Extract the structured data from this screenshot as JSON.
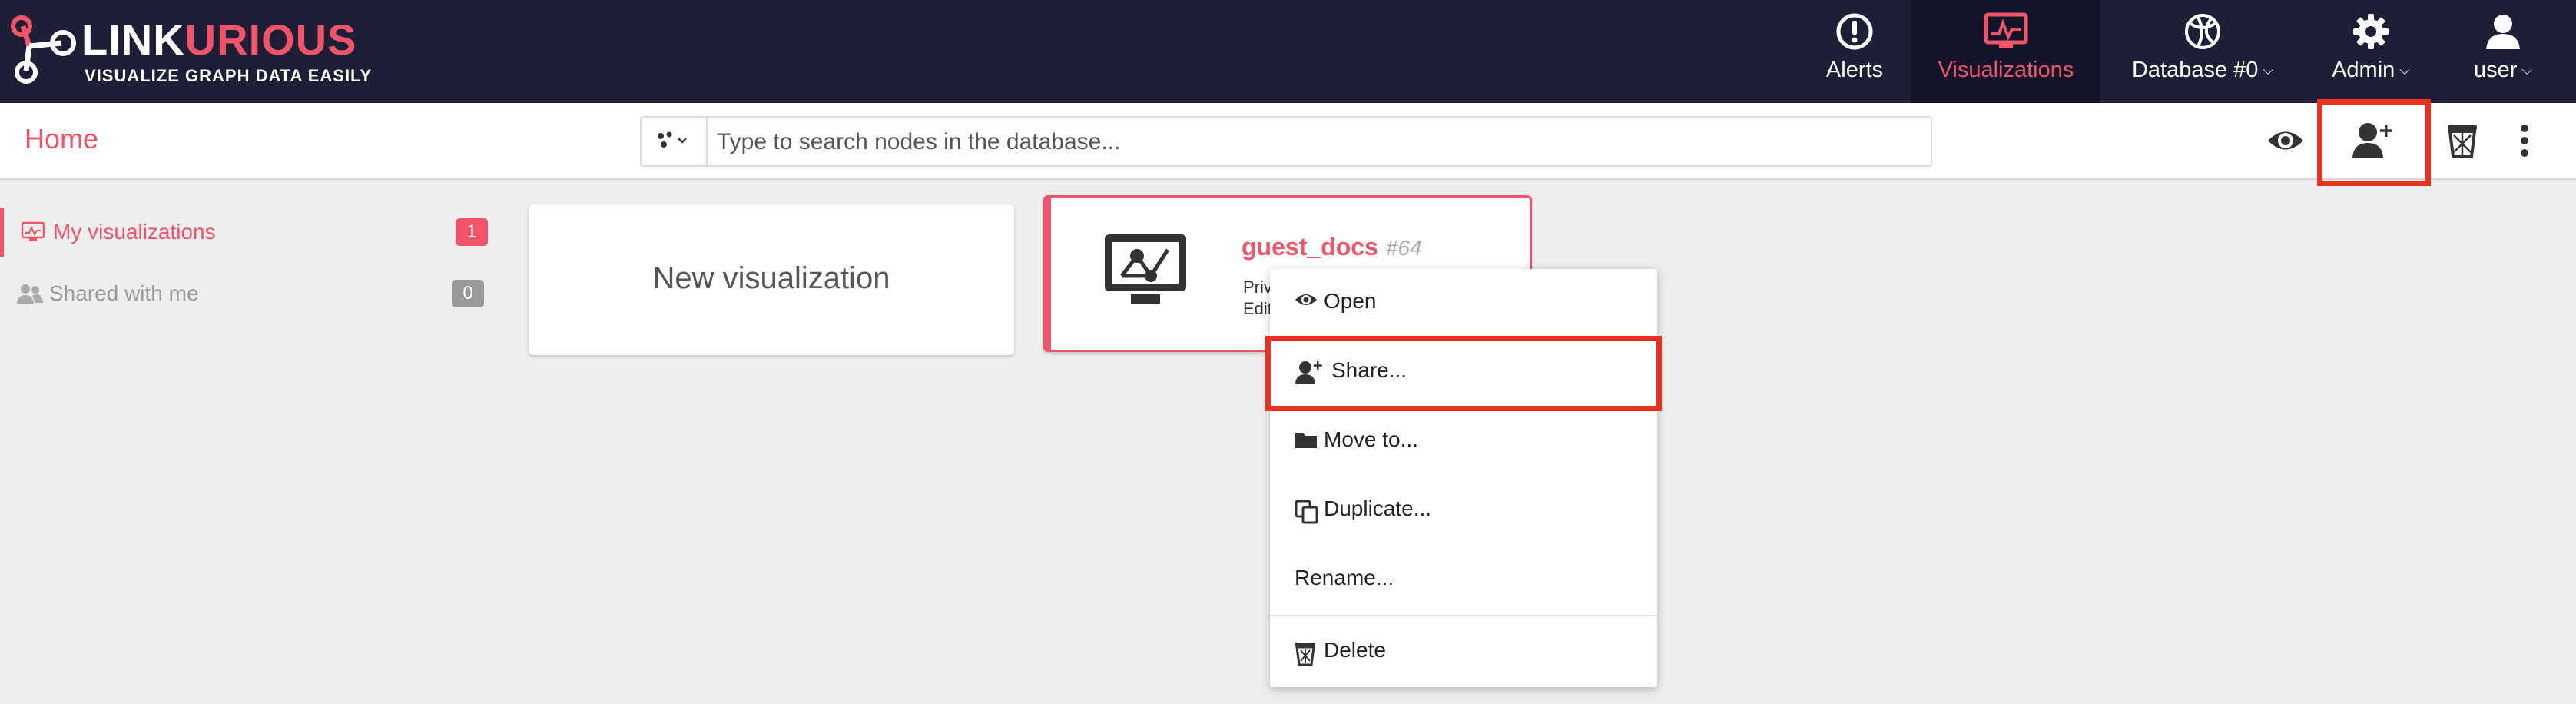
{
  "brand": {
    "name_part1": "LINK",
    "name_part2": "URIOUS",
    "tagline": "VISUALIZE GRAPH DATA EASILY"
  },
  "nav": {
    "alerts": {
      "label": "Alerts",
      "icon": "alert-circle-icon"
    },
    "visualizations": {
      "label": "Visualizations",
      "icon": "monitor-graph-icon",
      "active": true
    },
    "database": {
      "label": "Database #0",
      "icon": "globe-icon"
    },
    "admin": {
      "label": "Admin",
      "icon": "gear-icon"
    },
    "user": {
      "label": "user",
      "icon": "user-icon"
    },
    "caret": "⌵"
  },
  "header": {
    "breadcrumb": "Home",
    "search": {
      "placeholder": "Type to search nodes in the database...",
      "value": ""
    },
    "tools": [
      "eye-icon",
      "share-user-icon",
      "trash-icon",
      "more-vertical-icon"
    ]
  },
  "sidebar": {
    "items": [
      {
        "label": "My visualizations",
        "count": "1",
        "active": true,
        "icon": "monitor-icon"
      },
      {
        "label": "Shared with me",
        "count": "0",
        "active": false,
        "icon": "users-icon"
      }
    ]
  },
  "cards": {
    "new_label": "New visualization",
    "viz": {
      "title": "guest_docs",
      "id": "#64",
      "line1": "Priva",
      "line2": "Edite"
    }
  },
  "context_menu": {
    "items": [
      {
        "label": "Open",
        "icon": "eye-icon"
      },
      {
        "label": "Share...",
        "icon": "share-user-icon"
      },
      {
        "label": "Move to...",
        "icon": "folder-icon"
      },
      {
        "label": "Duplicate...",
        "icon": "copy-icon"
      },
      {
        "label": "Rename...",
        "icon": ""
      },
      {
        "label": "Delete",
        "icon": "trash-icon"
      }
    ]
  },
  "colors": {
    "accent": "#ef5468",
    "topbar": "#1e1f36",
    "highlight": "#e8321e",
    "background": "#eeeeee"
  }
}
